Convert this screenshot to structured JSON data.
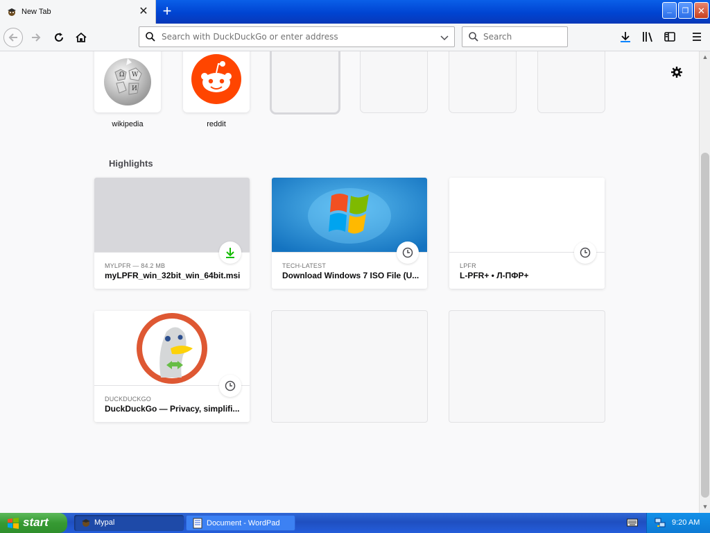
{
  "tab": {
    "title": "New Tab",
    "close_glyph": "✕",
    "new_tab_glyph": "+"
  },
  "window_controls": {
    "minimize": "_",
    "maximize": "❐",
    "close": "✕"
  },
  "toolbar": {
    "url_placeholder": "Search with DuckDuckGo or enter address",
    "search_placeholder": "Search",
    "icons": [
      "back-icon",
      "forward-icon",
      "reload-icon",
      "home-icon",
      "downloads-icon",
      "library-icon",
      "sidebar-icon",
      "menu-icon"
    ]
  },
  "top_sites": [
    {
      "label": "wikipedia"
    },
    {
      "label": "reddit"
    }
  ],
  "highlights": {
    "title": "Highlights",
    "cards": [
      {
        "source": "MYLPFR — 84.2 MB",
        "title": "myLPFR_win_32bit_win_64bit.msi",
        "badge": "download-icon"
      },
      {
        "source": "TECH-LATEST",
        "title": "Download Windows 7 ISO File (U...",
        "badge": "clock-icon"
      },
      {
        "source": "LPFR",
        "title": "L-PFR+ • Л-ПФР+",
        "badge": "clock-icon"
      },
      {
        "source": "DUCKDUCKGO",
        "title": "DuckDuckGo — Privacy, simplifi...",
        "badge": "clock-icon"
      }
    ]
  },
  "taskbar": {
    "start_label": "start",
    "tasks": [
      {
        "label": "Mypal"
      },
      {
        "label": "Document - WordPad"
      }
    ],
    "clock": "9:20 AM"
  },
  "colors": {
    "titlebar": "#0044d2",
    "download_green": "#12bc00",
    "reddit": "#ff4500",
    "duckduckgo": "#de5833"
  }
}
